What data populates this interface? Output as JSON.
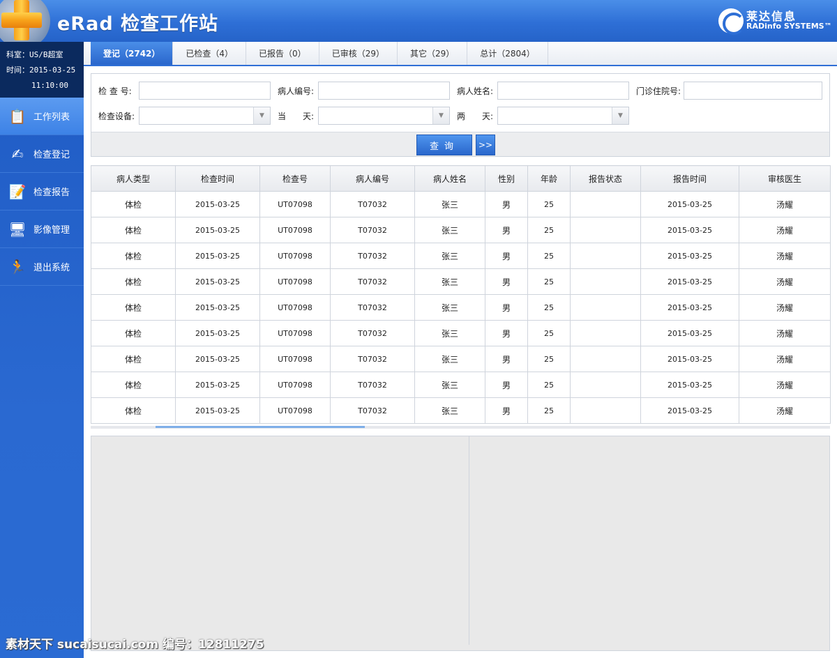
{
  "header": {
    "title": "eRad 检查工作站",
    "brand_cn": "莱达信息",
    "brand_en": "RADinfo SYSTEMS™"
  },
  "info": {
    "dept_label": "科室：",
    "dept_value": "US/B超室",
    "time_label": "时间：",
    "date": "2015-03-25",
    "time": "11:10:00"
  },
  "nav": [
    {
      "label": "工作列表",
      "icon": "worklist-icon",
      "active": true
    },
    {
      "label": "检查登记",
      "icon": "register-icon",
      "active": false
    },
    {
      "label": "检查报告",
      "icon": "report-icon",
      "active": false
    },
    {
      "label": "影像管理",
      "icon": "image-manage-icon",
      "active": false
    },
    {
      "label": "退出系统",
      "icon": "exit-icon",
      "active": false
    }
  ],
  "tabs": [
    {
      "label": "登记（2742）",
      "active": true
    },
    {
      "label": "已检查（4）",
      "active": false
    },
    {
      "label": "已报告（0）",
      "active": false
    },
    {
      "label": "已审核（29）",
      "active": false
    },
    {
      "label": "其它（29）",
      "active": false
    },
    {
      "label": "总计（2804）",
      "active": false
    }
  ],
  "search": {
    "exam_no_label": "检 查 号:",
    "patient_no_label": "病人编号:",
    "patient_name_label": "病人姓名:",
    "outpatient_no_label": "门诊住院号:",
    "device_label": "检查设备:",
    "today_label": "当　　天:",
    "two_days_label": "两　　天:",
    "query_button": "查询",
    "more_button": ">>"
  },
  "table": {
    "columns": [
      "病人类型",
      "检查时间",
      "检查号",
      "病人编号",
      "病人姓名",
      "性别",
      "年龄",
      "报告状态",
      "报告时间",
      "审核医生"
    ],
    "rows": [
      [
        "体检",
        "2015-03-25",
        "UT07098",
        "T07032",
        "张三",
        "男",
        "25",
        "",
        "2015-03-25",
        "汤耀"
      ],
      [
        "体检",
        "2015-03-25",
        "UT07098",
        "T07032",
        "张三",
        "男",
        "25",
        "",
        "2015-03-25",
        "汤耀"
      ],
      [
        "体检",
        "2015-03-25",
        "UT07098",
        "T07032",
        "张三",
        "男",
        "25",
        "",
        "2015-03-25",
        "汤耀"
      ],
      [
        "体检",
        "2015-03-25",
        "UT07098",
        "T07032",
        "张三",
        "男",
        "25",
        "",
        "2015-03-25",
        "汤耀"
      ],
      [
        "体检",
        "2015-03-25",
        "UT07098",
        "T07032",
        "张三",
        "男",
        "25",
        "",
        "2015-03-25",
        "汤耀"
      ],
      [
        "体检",
        "2015-03-25",
        "UT07098",
        "T07032",
        "张三",
        "男",
        "25",
        "",
        "2015-03-25",
        "汤耀"
      ],
      [
        "体检",
        "2015-03-25",
        "UT07098",
        "T07032",
        "张三",
        "男",
        "25",
        "",
        "2015-03-25",
        "汤耀"
      ],
      [
        "体检",
        "2015-03-25",
        "UT07098",
        "T07032",
        "张三",
        "男",
        "25",
        "",
        "2015-03-25",
        "汤耀"
      ],
      [
        "体检",
        "2015-03-25",
        "UT07098",
        "T07032",
        "张三",
        "男",
        "25",
        "",
        "2015-03-25",
        "汤耀"
      ]
    ]
  },
  "watermark": "素材天下 sucaisucai.com  编号：12811275",
  "colors": {
    "header_blue": "#2e6fd6",
    "sidebar_blue": "#2a69d1",
    "info_dark": "#0b2a5e",
    "accent_orange": "#f7a21a"
  }
}
